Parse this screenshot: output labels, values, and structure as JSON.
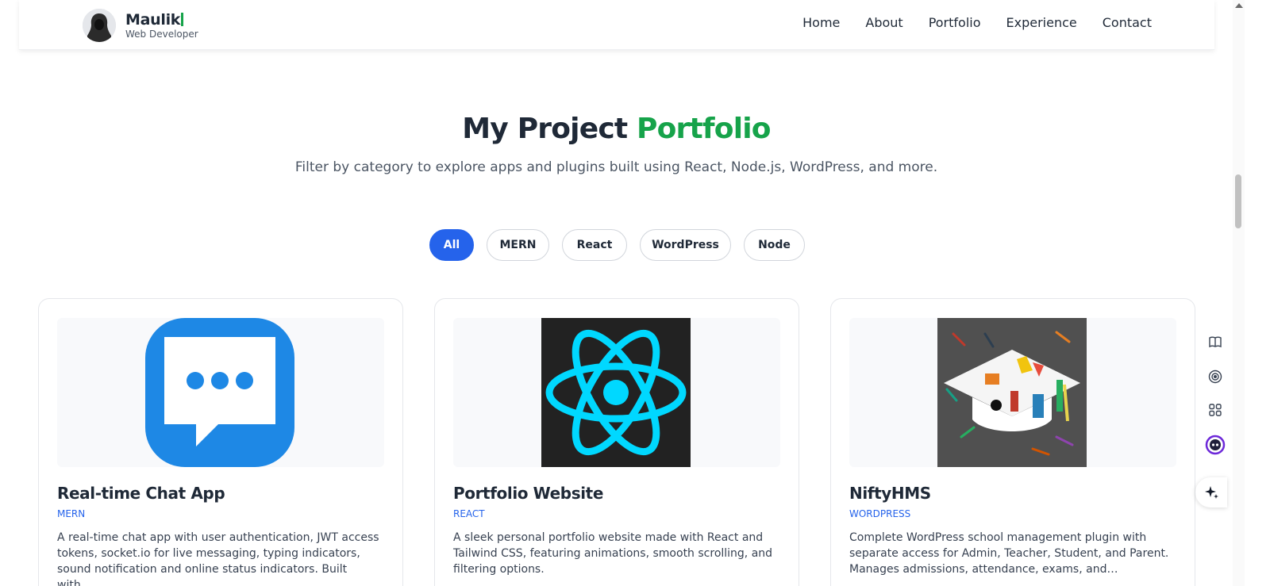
{
  "header": {
    "brand_name": "Maulik",
    "brand_subtitle": "Web Developer",
    "nav": [
      "Home",
      "About",
      "Portfolio",
      "Experience",
      "Contact"
    ]
  },
  "hero": {
    "title_part1": "My Project ",
    "title_part2": "Portfolio",
    "subtitle": "Filter by category to explore apps and plugins built using React, Node.js, WordPress, and more."
  },
  "filters": {
    "items": [
      "All",
      "MERN",
      "React",
      "WordPress",
      "Node"
    ],
    "active": "All"
  },
  "projects": [
    {
      "title": "Real-time Chat App",
      "category": "MERN",
      "description": "A real-time chat app with user authentication, JWT access tokens, socket.io for live messaging, typing indicators, sound notification and online status indicators. Built with…",
      "image_icon": "chat-bubble-icon"
    },
    {
      "title": "Portfolio Website",
      "category": "REACT",
      "description": "A sleek personal portfolio website made with React and Tailwind CSS, featuring animations, smooth scrolling, and filtering options.",
      "image_icon": "react-logo-icon"
    },
    {
      "title": "NiftyHMS",
      "category": "WORDPRESS",
      "description": "Complete WordPress school management plugin with separate access for Admin, Teacher, Student, and Parent. Manages admissions, attendance, exams, and…",
      "image_icon": "graduation-cap-icon"
    }
  ],
  "colors": {
    "accent_green": "#16a34a",
    "active_blue": "#2563eb",
    "chat_blue": "#1e88e5",
    "react_cyan": "#00d8ff"
  }
}
